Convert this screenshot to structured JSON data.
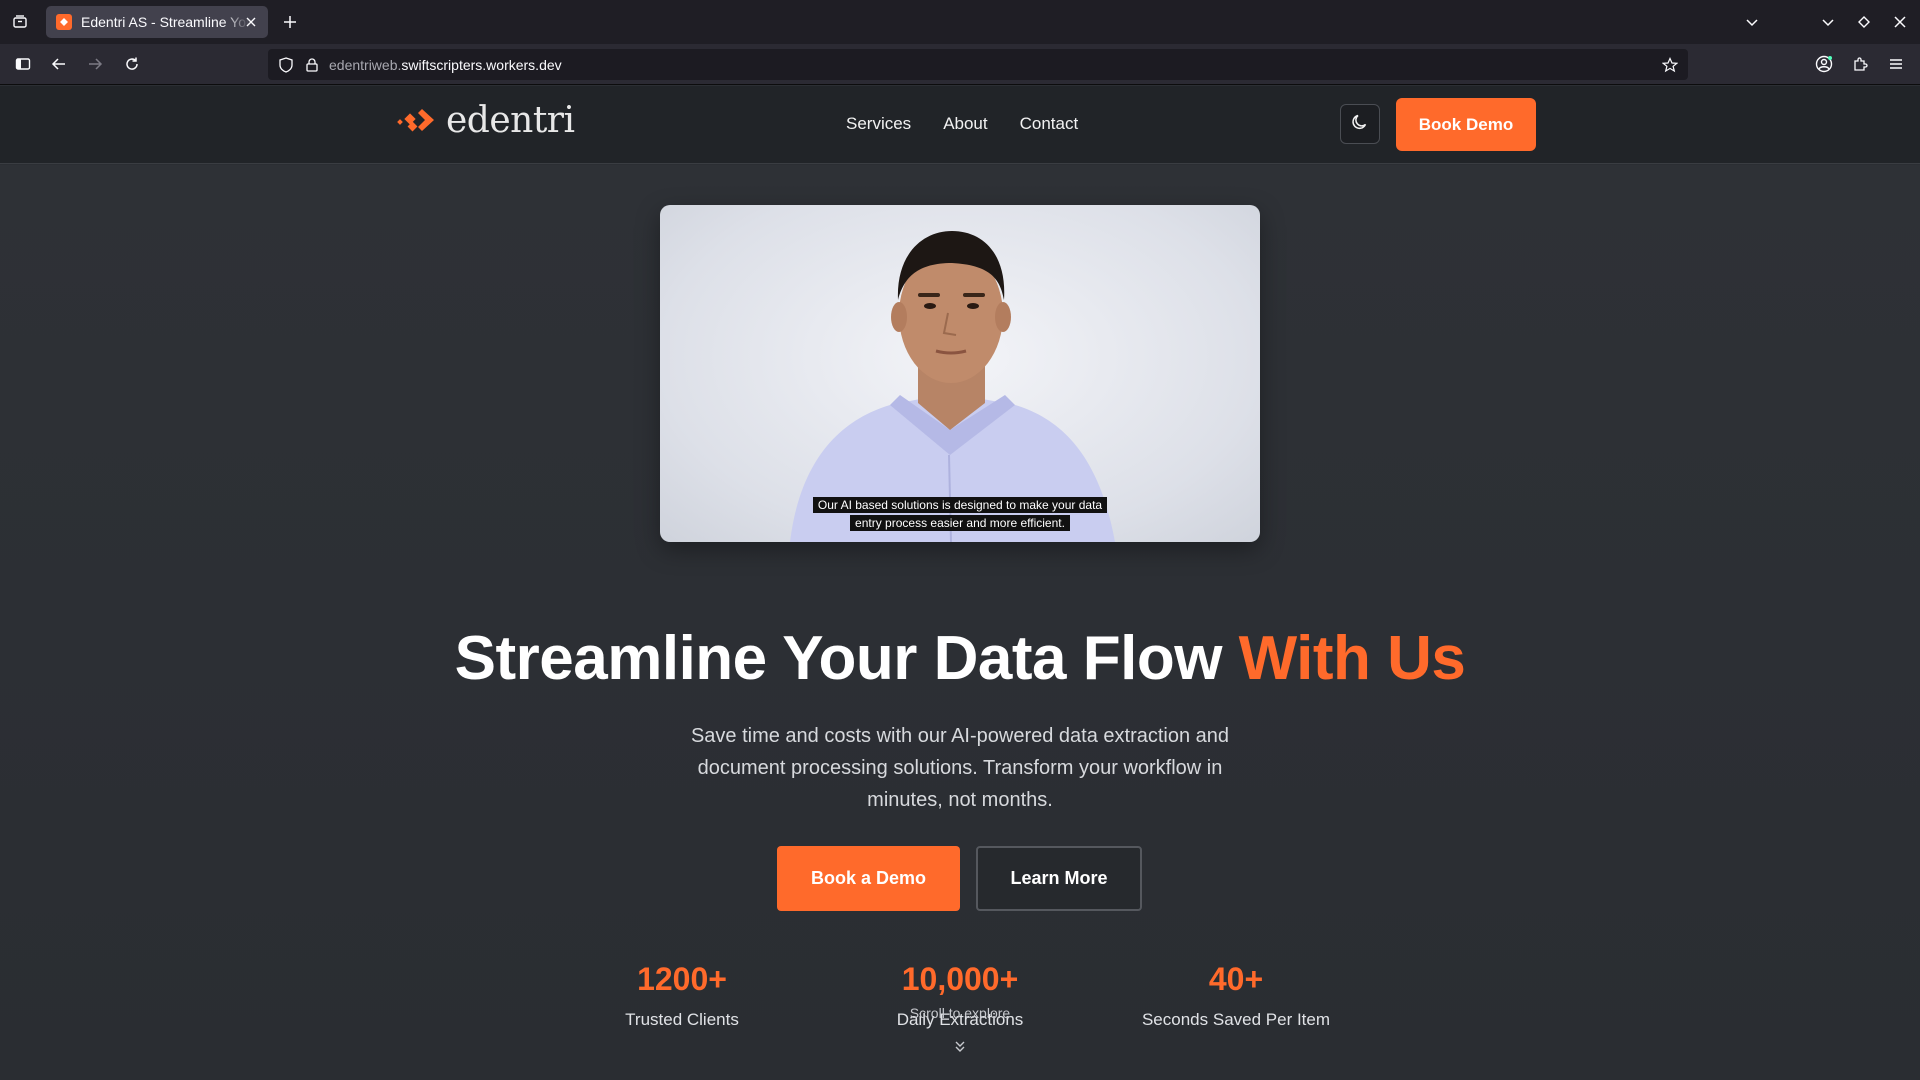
{
  "browser": {
    "tab_title": "Edentri AS - Streamline Your Data Flow",
    "url_dim": "edentriweb.",
    "url_main": "swiftscripters.workers.dev"
  },
  "header": {
    "logo_text": "edentri",
    "nav": [
      "Services",
      "About",
      "Contact"
    ],
    "cta": "Book Demo"
  },
  "hero": {
    "video_caption_line1": "Our AI based solutions is designed to make your data",
    "video_caption_line2": "entry process easier and more efficient.",
    "headline_main": "Streamline Your Data Flow ",
    "headline_accent": "With Us",
    "subtext": "Save time and costs with our AI-powered data extraction and document processing solutions. Transform your workflow in minutes, not months.",
    "primary_button": "Book a Demo",
    "secondary_button": "Learn More",
    "scroll_hint": "Scroll to explore"
  },
  "stats": [
    {
      "value": "1200+",
      "label": "Trusted Clients"
    },
    {
      "value": "10,000+",
      "label": "Daily Extractions"
    },
    {
      "value": "40+",
      "label": "Seconds Saved Per Item"
    }
  ],
  "colors": {
    "accent": "#ff6a2b",
    "header_bg": "#212428",
    "hero_bg": "#2e3136"
  },
  "icons": [
    "tab-list-icon",
    "close-icon",
    "plus-icon",
    "chevron-down-icon",
    "minimize-icon",
    "maximize-icon",
    "sidebar-icon",
    "back-arrow-icon",
    "forward-arrow-icon",
    "reload-icon",
    "shield-icon",
    "lock-icon",
    "star-icon",
    "account-icon",
    "extensions-icon",
    "menu-icon",
    "moon-icon"
  ]
}
